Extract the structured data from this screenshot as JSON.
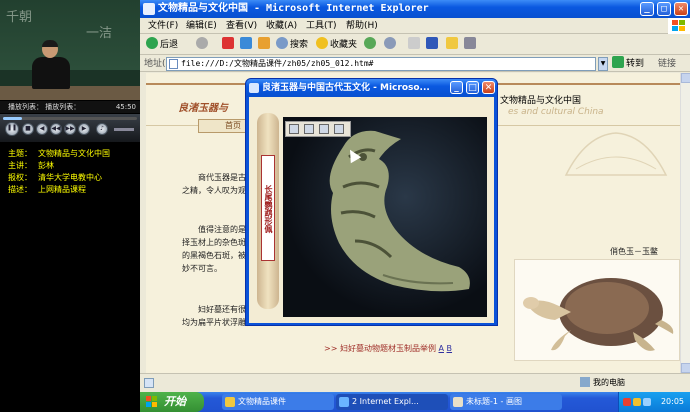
{
  "player": {
    "playlist_label": "播放列表：",
    "playlist_value": "播放列表：",
    "time": "45:50",
    "progress": 0.14,
    "info": [
      {
        "key": "主题：",
        "value": "文物精品与文化中国"
      },
      {
        "key": "主讲：",
        "value": "彭林"
      },
      {
        "key": "报权：",
        "value": "清华大学电教中心"
      },
      {
        "key": "描述：",
        "value": "上网精品课程"
      }
    ]
  },
  "ie": {
    "title": "文物精品与文化中国 - Microsoft Internet Explorer",
    "menu": [
      "文件(F)",
      "编辑(E)",
      "查看(V)",
      "收藏(A)",
      "工具(T)",
      "帮助(H)"
    ],
    "toolbar": {
      "back": "后退",
      "search": "搜索",
      "favorites": "收藏夹"
    },
    "address_label": "地址(D)",
    "address": "file:///D:/文物精品课件/zh05/zh05_012.htm#",
    "go": "转到",
    "links": "链接",
    "status_zone": "我的电脑"
  },
  "page": {
    "logo": "良渚玉器与",
    "site_title": "文物精品与文化中国",
    "site_sub": "es and cultural China",
    "nav_home": "首页",
    "para1": [
      "商代玉器是古代玉器",
      "之精，令人叹为观止。"
    ],
    "para2": [
      "值得注意的是，商代",
      "择玉材上的杂色斑点，",
      "的黑褐色石斑，被安排",
      "妙不可言。"
    ],
    "para3": [
      "妇好墓还有很多的",
      "均为扁平片状浮雕，外"
    ],
    "caption_right": "俏色玉－玉鳖",
    "link_text": ">> 妇好墓动物题材玉制品举例",
    "link_a": "A",
    "link_b": "B"
  },
  "popup": {
    "title": "良渚玉器与中国古代玉文化 - Microso...",
    "vertical_text": "长尾鹦鹉形佩"
  },
  "taskbar": {
    "start": "开始",
    "tasks": [
      "文物精品课件",
      "2 Internet Expl...",
      "未标题-1 - 画图"
    ],
    "clock": "20:05"
  },
  "colors": {
    "title_blue": "#0a58e0",
    "page_bg": "#f6f1dc",
    "player_text": "#ffff00",
    "start_green": "#4fb34a"
  }
}
